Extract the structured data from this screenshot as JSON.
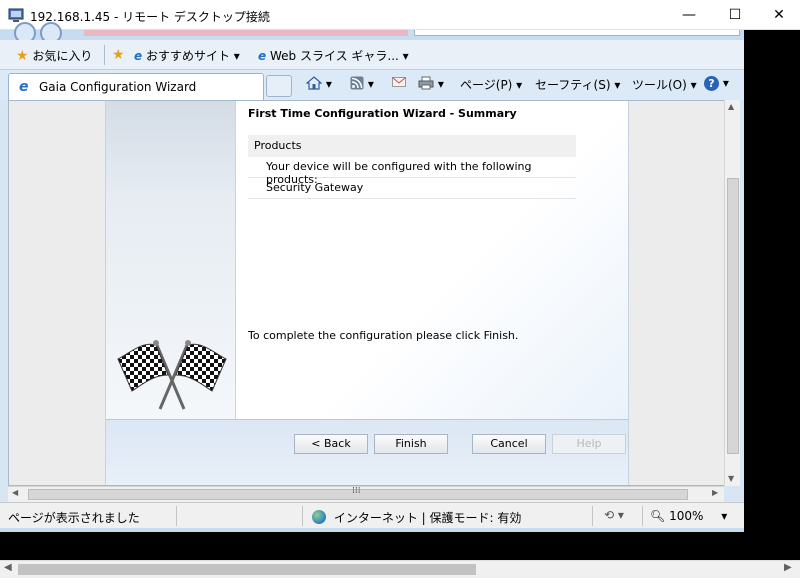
{
  "remote_desktop": {
    "title": "192.168.1.45 - リモート デスクトップ接続",
    "minimize": "—",
    "maximize": "☐",
    "close": "✕"
  },
  "favorites_bar": {
    "favorites_label": "お気に入り",
    "recommended_sites": "おすすめサイト ▾",
    "web_slices": "Web スライス ギャラ... ▾"
  },
  "tab": {
    "title": "Gaia Configuration Wizard"
  },
  "command_bar": {
    "home_arrow": "▾",
    "feeds_arrow": "▾",
    "print_arrow": "▾",
    "page": "ページ(P) ▾",
    "safety": "セーフティ(S) ▾",
    "tools": "ツール(O) ▾",
    "help_arrow": "▾"
  },
  "wizard": {
    "title": "First Time Configuration Wizard - Summary",
    "products_header": "Products",
    "products_rows": [
      "Your device will be configured with the following products:",
      "Security Gateway"
    ],
    "complete_message": "To complete the configuration please click Finish.",
    "buttons": {
      "back": "< Back",
      "finish": "Finish",
      "cancel": "Cancel",
      "help": "Help"
    }
  },
  "scrollbars": {
    "grip": "⁞⁞⁞"
  },
  "status_bar": {
    "message": "ページが表示されました",
    "zone": "インターネット | 保護モード: 有効",
    "zoom": "100%",
    "zoom_arrow": "▾",
    "protect_arrow": "▾"
  },
  "colors": {
    "ie_chrome": "#d8e6f4",
    "wizard_footer": "#dbe7f4",
    "help_icon": "#2b62b8"
  }
}
